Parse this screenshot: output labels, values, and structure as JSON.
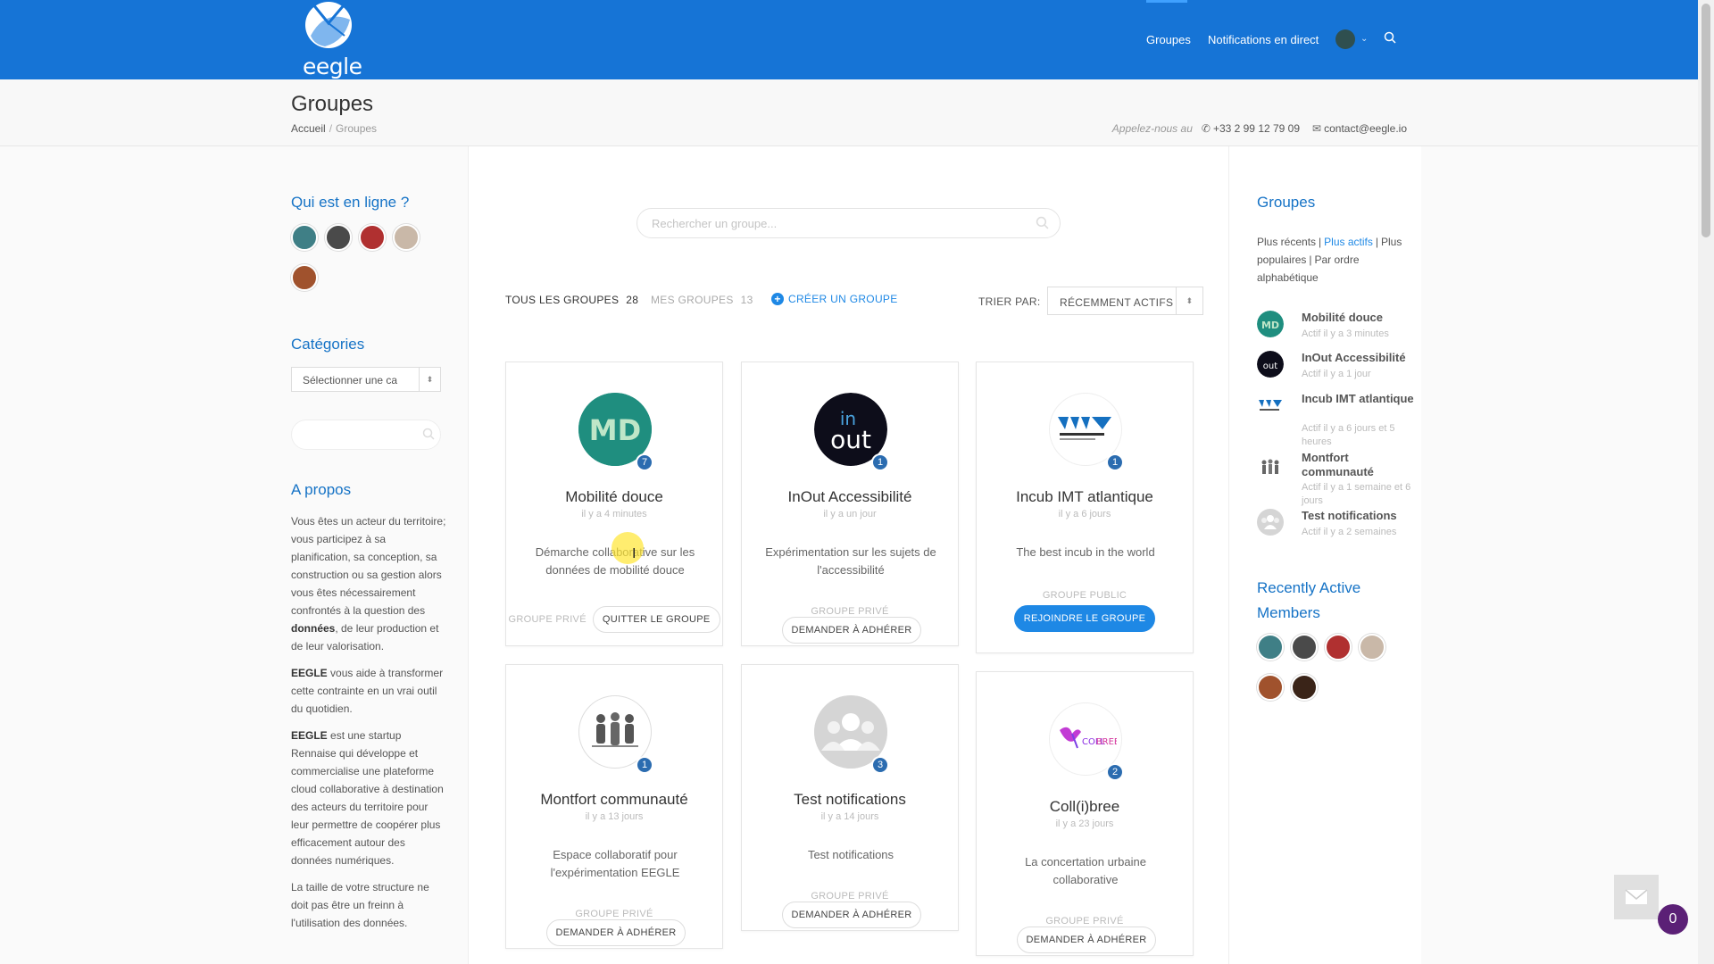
{
  "header": {
    "logo_text": "eegle",
    "nav": [
      "Groupes",
      "Notifications en direct"
    ],
    "colors": {
      "bar": "#1674d6",
      "accent": "#1e88e5",
      "heading": "#1673c6"
    }
  },
  "page": {
    "title": "Groupes",
    "breadcrumb": {
      "home": "Accueil",
      "sep": "/",
      "current": "Groupes"
    },
    "contact": {
      "call_label": "Appelez-nous au",
      "phone": "+33 2 99 12 79 09",
      "email": "contact@eegle.io"
    }
  },
  "left": {
    "online_title": "Qui est en ligne ?",
    "categories_title": "Catégories",
    "category_select": "Sélectionner une ca",
    "about_title": "A propos",
    "about": {
      "p1_a": "Vous êtes un acteur du territoire; vous participez à sa planification, sa conception, sa construction ou sa gestion alors vous êtes nécessairement confrontés à la question des ",
      "p1_b": "données",
      "p1_c": ", de leur production et de leur valorisation.",
      "p2_a": "EEGLE",
      "p2_b": " vous aide à transformer cette contrainte en un vrai outil du quotidien.",
      "p3_a": "EEGLE",
      "p3_b": " est une startup Rennaise qui développe et commercialise une plateforme cloud collaborative à destination des acteurs du territoire pour leur permettre de coopérer plus efficacement autour des données numériques.",
      "p4": "La taille de votre structure ne doit pas être un freinn à l'utilisation des données."
    }
  },
  "main": {
    "search_placeholder": "Rechercher un groupe...",
    "tab_all": "TOUS LES GROUPES",
    "tab_all_count": "28",
    "tab_mine": "MES GROUPES",
    "tab_mine_count": "13",
    "create": "CRÉER UN GROUPE",
    "sort_label": "TRIER PAR:",
    "sort_value": "RÉCEMMENT ACTIFS",
    "cards": [
      {
        "name": "Mobilité douce",
        "time": "il y a 4 minutes",
        "desc": "Démarche collaborative sur les données de mobilité douce",
        "kind": "GROUPE PRIVÉ",
        "action": "QUITTER LE GROUPE",
        "badge": "7",
        "icon": "md-logo"
      },
      {
        "name": "InOut Accessibilité",
        "time": "il y a un jour",
        "desc": "Expérimentation sur les sujets de l'accessibilité",
        "kind": "GROUPE PRIVÉ",
        "action": "DEMANDER À ADHÉRER",
        "badge": "1",
        "icon": "inout-logo"
      },
      {
        "name": "Incub IMT atlantique",
        "time": "il y a 6 jours",
        "desc": "The best incub in the world",
        "kind": "GROUPE PUBLIC",
        "action": "REJOINDRE LE GROUPE",
        "badge": "1",
        "icon": "imt-logo"
      },
      {
        "name": "Montfort communauté",
        "time": "il y a 13 jours",
        "desc": "Espace collaboratif pour l'expérimentation EEGLE",
        "kind": "GROUPE PRIVÉ",
        "action": "DEMANDER À ADHÉRER",
        "badge": "1",
        "icon": "people-logo"
      },
      {
        "name": "Test notifications",
        "time": "il y a 14 jours",
        "desc": "Test notifications",
        "kind": "GROUPE PRIVÉ",
        "action": "DEMANDER À ADHÉRER",
        "badge": "3",
        "icon": "default-group-icon"
      },
      {
        "name": "Coll(i)bree",
        "time": "il y a 23 jours",
        "desc": "La concertation urbaine collaborative",
        "kind": "GROUPE PRIVÉ",
        "action": "DEMANDER À ADHÉRER",
        "badge": "2",
        "icon": "collibree-logo"
      }
    ]
  },
  "right": {
    "groups_title": "Groupes",
    "sort": {
      "recent": "Plus récents",
      "active": "Plus actifs",
      "popular": "Plus populaires",
      "alpha": "Par ordre alphabétique",
      "sep": "|"
    },
    "groups": [
      {
        "name": "Mobilité douce",
        "activity": "Actif il y a 3 minutes"
      },
      {
        "name": "InOut Accessibilité",
        "activity": "Actif il y a 1 jour"
      },
      {
        "name": "Incub IMT atlantique",
        "activity": "Actif il y a 6 jours et 5 heures"
      },
      {
        "name": "Montfort communauté",
        "activity": "Actif il y a 1 semaine et 6 jours"
      },
      {
        "name": "Test notifications",
        "activity": "Actif il y a 2 semaines"
      }
    ],
    "members_title": "Recently Active Members"
  },
  "widget": {
    "count": "0"
  }
}
